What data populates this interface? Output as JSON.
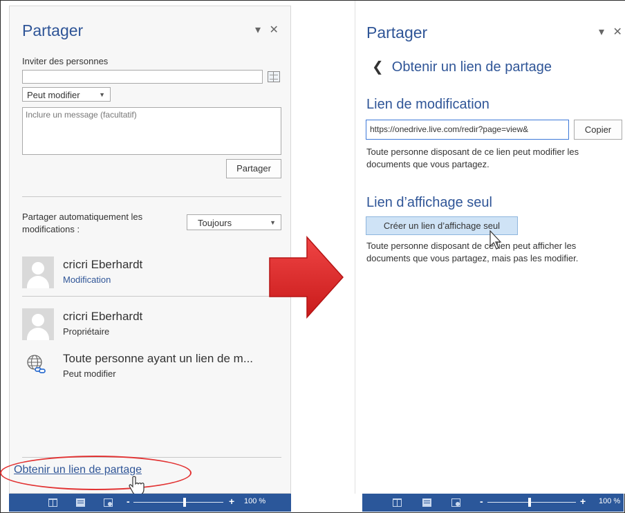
{
  "left_pane": {
    "title": "Partager",
    "window_controls": "▾ ✕",
    "invite_label": "Inviter des personnes",
    "invite_value": "",
    "permission_select": "Peut modifier",
    "message_placeholder": "Inclure un message (facultatif)",
    "share_button": "Partager",
    "auto_share_label": "Partager automatiquement les modifications :",
    "auto_share_select": "Toujours",
    "people": [
      {
        "name": "cricri Eberhardt",
        "role": "Modification"
      },
      {
        "name": "cricri Eberhardt",
        "role": "Propriétaire"
      },
      {
        "name": "Toute personne ayant un lien de m...",
        "role": "Peut modifier"
      }
    ],
    "get_link": "Obtenir un lien de partage"
  },
  "right_pane": {
    "title": "Partager",
    "window_controls": "▾ ✕",
    "back_label": "Obtenir un lien de partage",
    "edit_link": {
      "heading": "Lien de modification",
      "url": "https://onedrive.live.com/redir?page=view&",
      "copy_button": "Copier",
      "description": "Toute personne disposant de ce lien peut modifier les documents que vous partagez."
    },
    "view_link": {
      "heading": "Lien d’affichage seul",
      "create_button": "Créer un lien d’affichage seul",
      "description": "Toute personne disposant de ce lien peut afficher les documents que vous partagez, mais pas les modifier."
    }
  },
  "status_bar": {
    "left_zoom_minus": "-",
    "left_zoom_plus": "+",
    "left_zoom": "100 %",
    "right_zoom_minus": "-",
    "right_zoom_plus": "+",
    "right_zoom": "100 %"
  },
  "colors": {
    "accent_blue": "#2f5597",
    "status_bar": "#2b579a",
    "highlight_red": "#e23333",
    "create_button_bg": "#cfe3f6"
  }
}
